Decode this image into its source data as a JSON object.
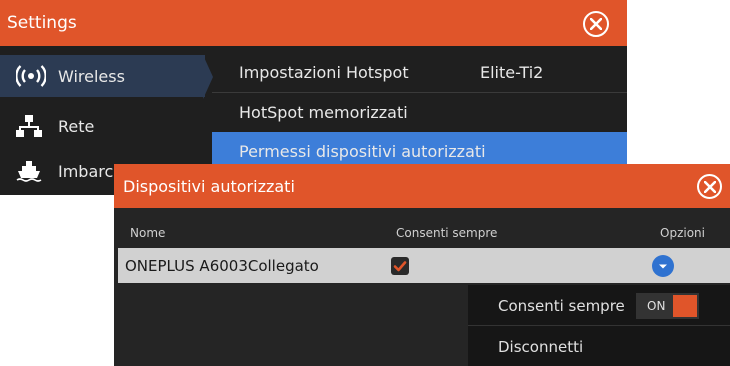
{
  "colors": {
    "accent": "#e0552a",
    "selection": "#3d7ed9",
    "sidebar_active": "#2c3b53"
  },
  "settings": {
    "title": "Settings",
    "sidebar": [
      {
        "label": "Wireless",
        "icon": "wifi-icon",
        "active": true
      },
      {
        "label": "Rete",
        "icon": "network-icon",
        "active": false
      },
      {
        "label": "Imbarc",
        "icon": "vessel-icon",
        "active": false
      }
    ],
    "menu": [
      {
        "label": "Impostazioni Hotspot",
        "value": "Elite-Ti2"
      },
      {
        "label": "HotSpot memorizzati",
        "value": ""
      },
      {
        "label": "Permessi dispositivi autorizzati",
        "value": "",
        "selected": true
      }
    ]
  },
  "dialog": {
    "title": "Dispositivi autorizzati",
    "columns": {
      "name": "Nome",
      "always_allow": "Consenti sempre",
      "options": "Opzioni"
    },
    "rows": [
      {
        "name": "ONEPLUS A6003Collegato",
        "always_allow": true
      }
    ]
  },
  "context_menu": {
    "always_allow_label": "Consenti sempre",
    "toggle_state": "ON",
    "disconnect_label": "Disconnetti"
  }
}
